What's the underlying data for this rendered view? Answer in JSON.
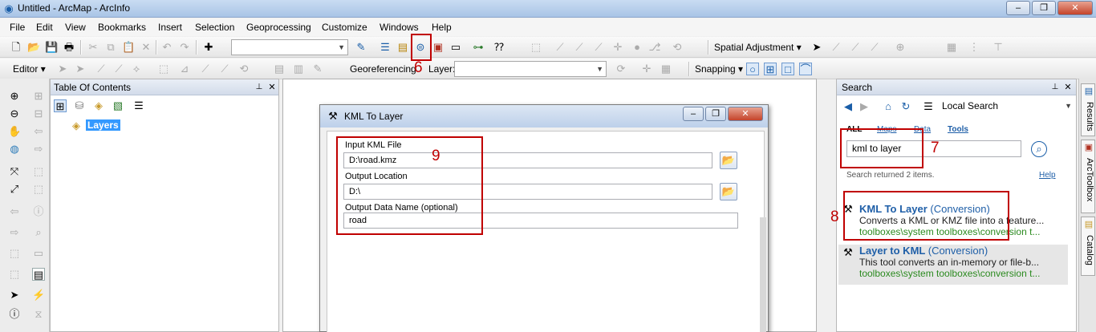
{
  "window": {
    "title": "Untitled - ArcMap - ArcInfo",
    "min": "–",
    "max": "❐",
    "close": "✕"
  },
  "menu": [
    "File",
    "Edit",
    "View",
    "Bookmarks",
    "Insert",
    "Selection",
    "Geoprocessing",
    "Customize",
    "Windows",
    "Help"
  ],
  "toolbar2": {
    "spatial_adjustment": "Spatial Adjustment"
  },
  "toolbar3": {
    "editor": "Editor",
    "georeferencing": "Georeferencing",
    "layer_label": "Layer:",
    "snapping": "Snapping"
  },
  "toc": {
    "title": "Table Of Contents",
    "layers_label": "Layers"
  },
  "dialog": {
    "title": "KML To Layer",
    "input_kml_label": "Input KML File",
    "input_kml_value": "D:\\road.kmz",
    "output_location_label": "Output Location",
    "output_location_value": "D:\\",
    "output_name_label": "Output Data Name (optional)",
    "output_name_value": "road"
  },
  "search": {
    "title": "Search",
    "scope": "Local Search",
    "tabs": [
      "ALL",
      "Maps",
      "Data",
      "Tools"
    ],
    "query": "kml to layer",
    "status": "Search returned 2 items.",
    "help": "Help",
    "results": [
      {
        "name": "KML To Layer",
        "category": "(Conversion)",
        "desc": "Converts a KML or KMZ file into a feature...",
        "path": "toolboxes\\system toolboxes\\conversion t..."
      },
      {
        "name": "Layer to KML",
        "category": "(Conversion)",
        "desc": "This tool converts an in-memory or file-b...",
        "path": "toolboxes\\system toolboxes\\conversion t..."
      }
    ]
  },
  "dock": [
    "Results",
    "ArcToolbox",
    "Catalog"
  ],
  "annotations": [
    "6",
    "7",
    "8",
    "9"
  ],
  "colors": {
    "annotation": "#c00000",
    "link": "#1f5fa8",
    "path": "#2b8a1f"
  }
}
